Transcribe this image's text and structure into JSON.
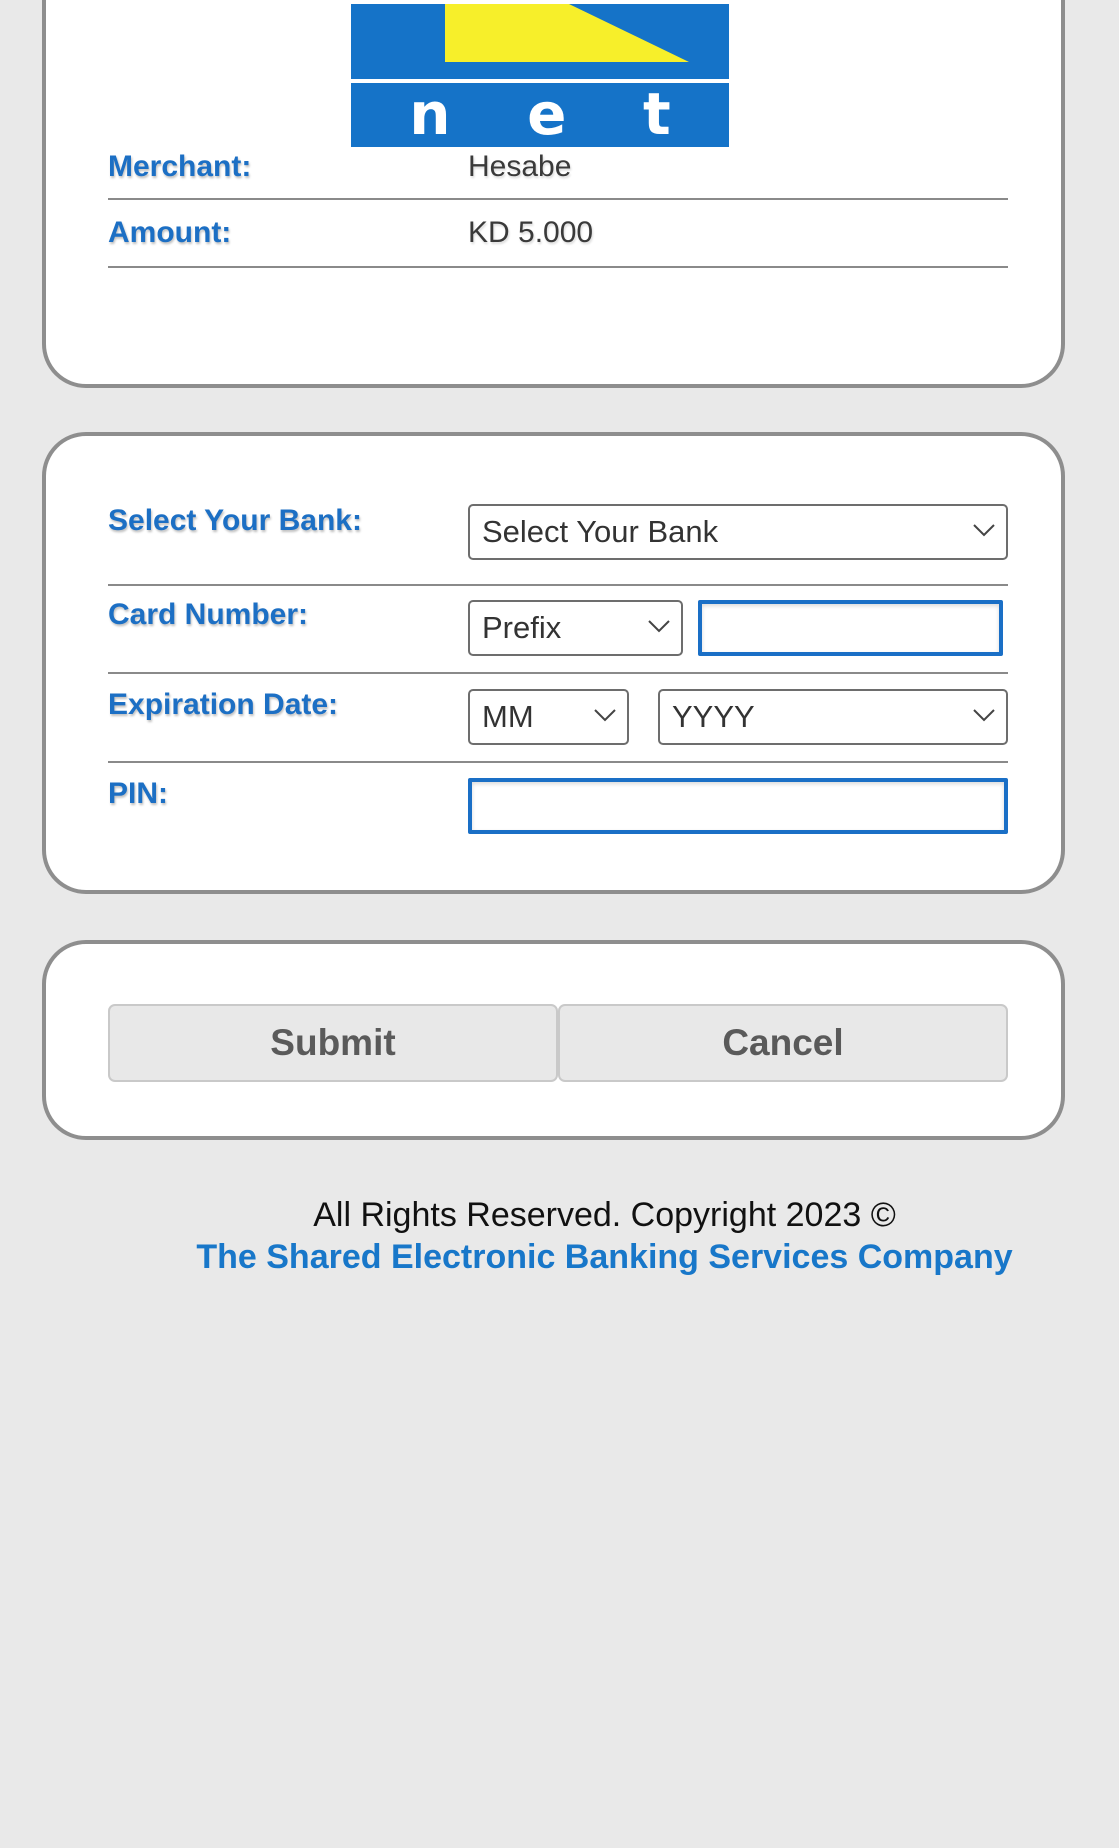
{
  "logo": {
    "text": [
      "n",
      "e",
      "t"
    ],
    "colors": {
      "background": "#1573c8",
      "letter": "#f7ef2a"
    }
  },
  "merchant_info": {
    "merchant_label": "Merchant:",
    "merchant_value": "Hesabe",
    "amount_label": "Amount:",
    "amount_value": "KD 5.000"
  },
  "form": {
    "bank": {
      "label": "Select Your Bank:",
      "selected": "Select Your Bank"
    },
    "card_number": {
      "label": "Card Number:",
      "prefix_selected": "Prefix",
      "number_value": ""
    },
    "expiration": {
      "label": "Expiration Date:",
      "month_selected": "MM",
      "year_selected": "YYYY"
    },
    "pin": {
      "label": "PIN:",
      "value": ""
    }
  },
  "actions": {
    "submit_label": "Submit",
    "cancel_label": "Cancel"
  },
  "footer": {
    "copyright": "All Rights Reserved. Copyright 2023 ©",
    "company": "The Shared Electronic Banking Services Company"
  },
  "colors": {
    "accent": "#1c6fc4",
    "page_background": "#e9e9e9"
  }
}
